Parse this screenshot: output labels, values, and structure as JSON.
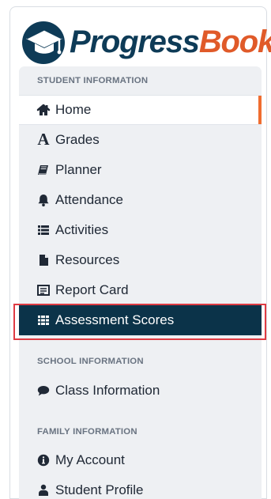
{
  "brand": {
    "name_part_1": "Progress",
    "name_part_2": "Book",
    "primary_color": "#0e3b57",
    "accent_color": "#e05a29"
  },
  "sections": {
    "student_information": "STUDENT INFORMATION",
    "school_information": "SCHOOL INFORMATION",
    "family_information": "FAMILY INFORMATION"
  },
  "nav": {
    "student_items": [
      {
        "label": "Home",
        "icon": "home-icon"
      },
      {
        "label": "Grades",
        "icon": "grade-letter-icon"
      },
      {
        "label": "Planner",
        "icon": "planner-icon"
      },
      {
        "label": "Attendance",
        "icon": "bell-icon"
      },
      {
        "label": "Activities",
        "icon": "list-icon"
      },
      {
        "label": "Resources",
        "icon": "file-icon"
      },
      {
        "label": "Report Card",
        "icon": "report-card-icon"
      },
      {
        "label": "Assessment Scores",
        "icon": "assessment-scores-icon"
      }
    ],
    "school_items": [
      {
        "label": "Class Information",
        "icon": "speech-bubble-icon"
      }
    ],
    "family_items": [
      {
        "label": "My Account",
        "icon": "info-circle-icon"
      },
      {
        "label": "Student Profile",
        "icon": "user-icon"
      }
    ],
    "active_item": "Assessment Scores",
    "highlight_color": "#df3b43"
  }
}
